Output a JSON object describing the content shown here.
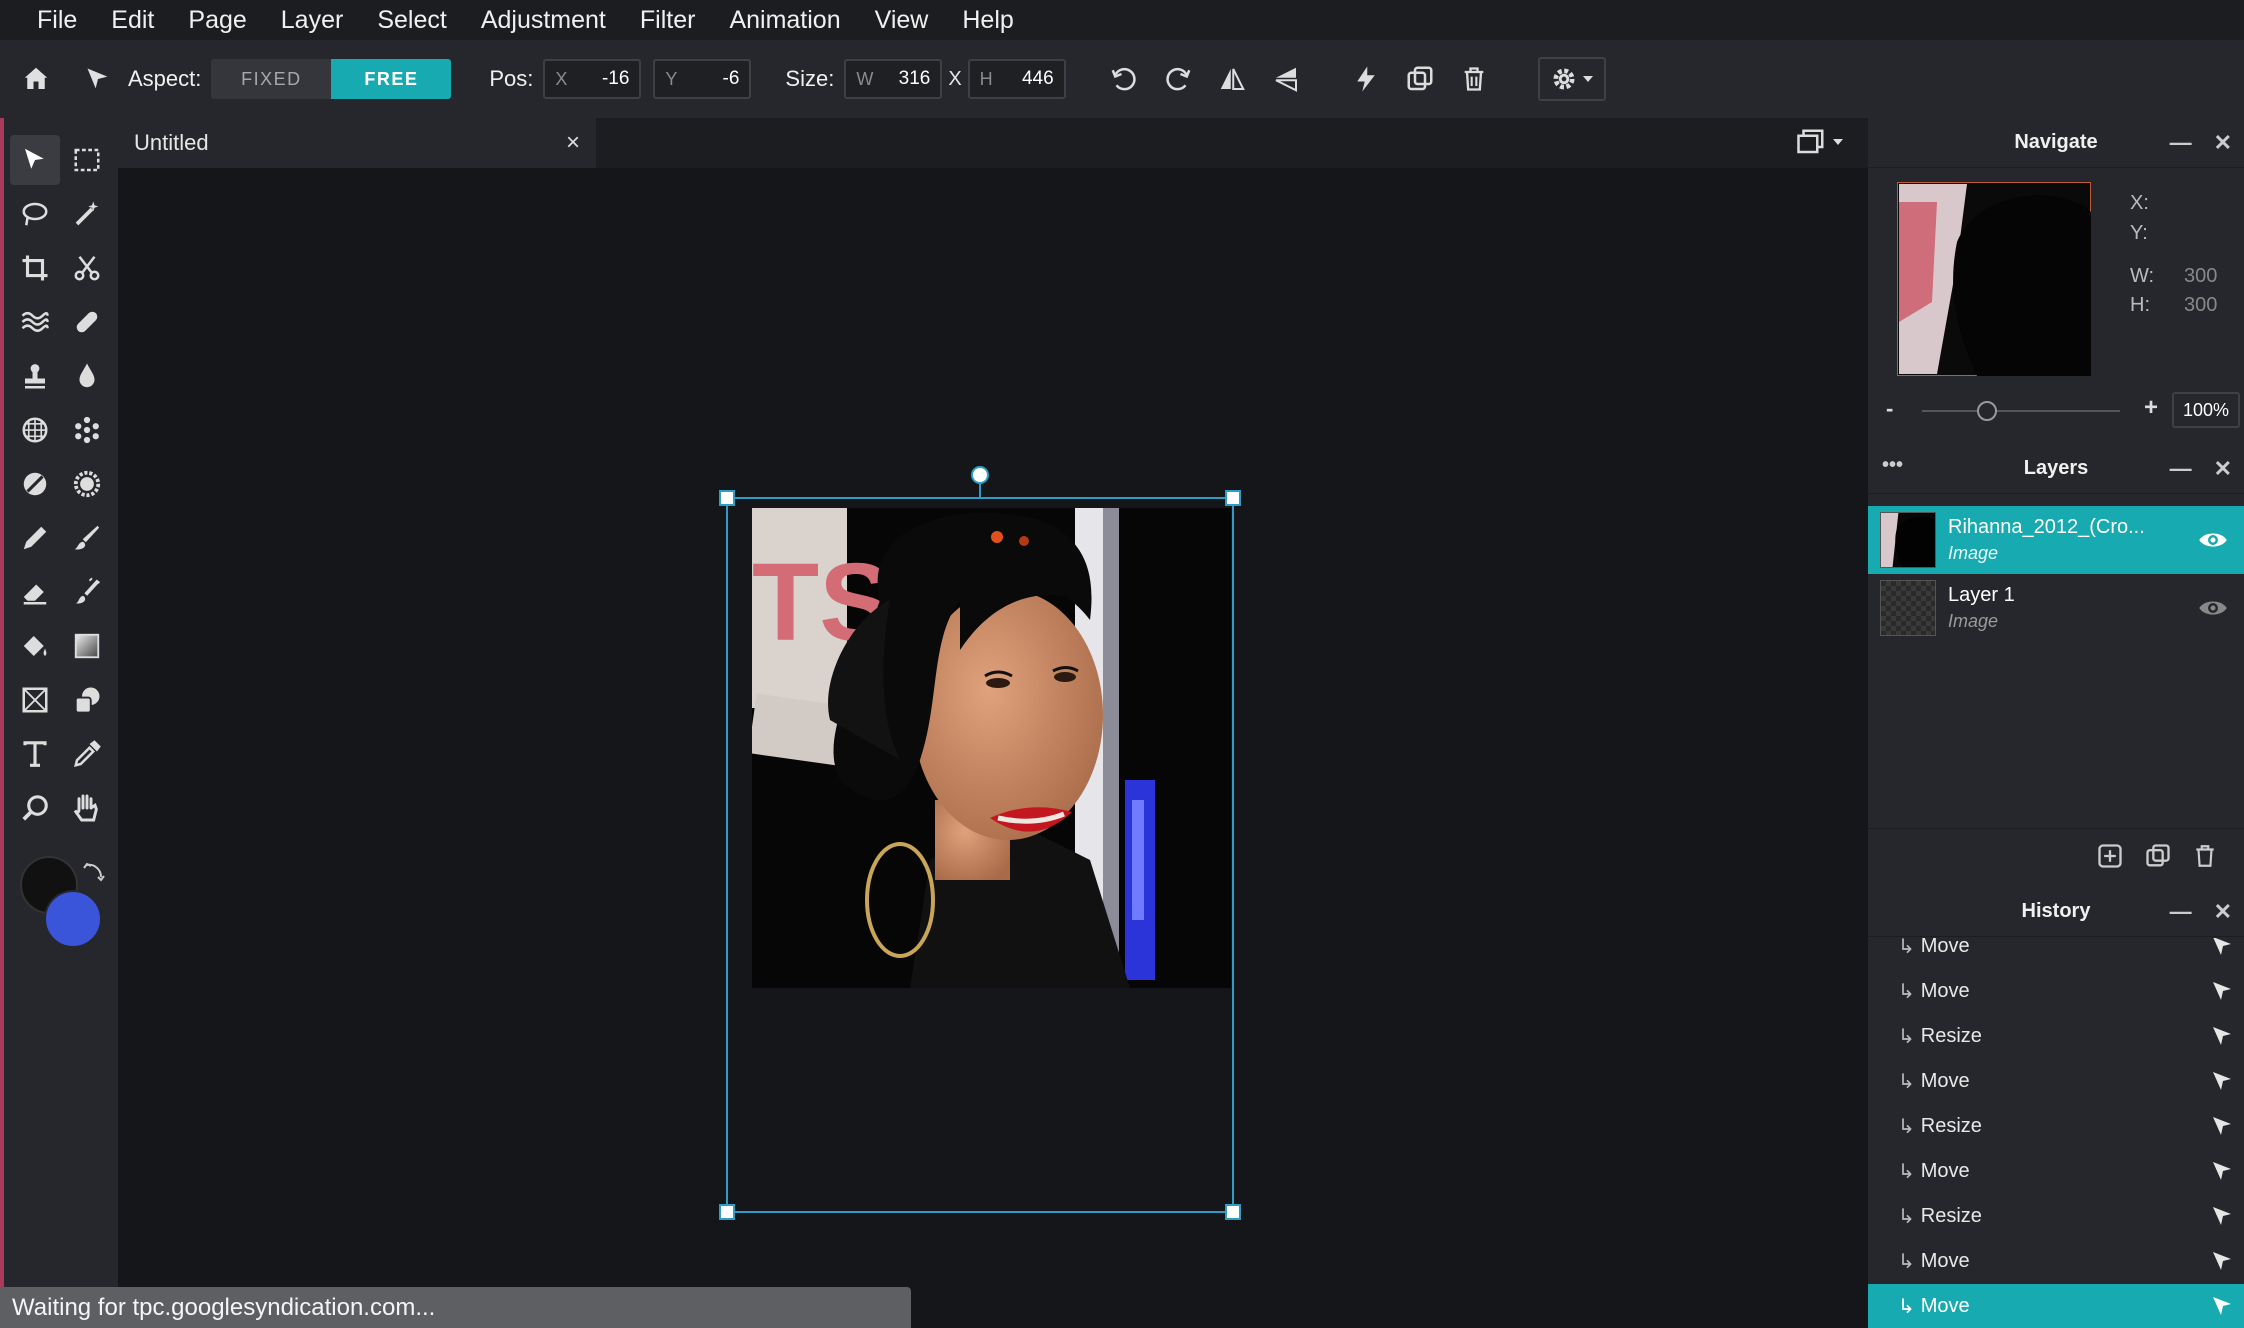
{
  "menu": [
    "File",
    "Edit",
    "Page",
    "Layer",
    "Select",
    "Adjustment",
    "Filter",
    "Animation",
    "View",
    "Help"
  ],
  "toolbar": {
    "aspect_label": "Aspect:",
    "fixed_label": "FIXED",
    "free_label": "FREE",
    "pos_label": "Pos:",
    "x_prefix": "X",
    "x_value": "-16",
    "y_prefix": "Y",
    "y_value": "-6",
    "size_label": "Size:",
    "w_prefix": "W",
    "w_value": "316",
    "times": "X",
    "h_prefix": "H",
    "h_value": "446"
  },
  "document": {
    "tab_title": "Untitled",
    "close": "×"
  },
  "navigate": {
    "title": "Navigate",
    "x_label": "X:",
    "y_label": "Y:",
    "w_label": "W:",
    "w_value": "300",
    "h_label": "H:",
    "h_value": "300",
    "zoom_minus": "-",
    "zoom_plus": "+",
    "zoom_value": "100%",
    "zoom_level": 0.33
  },
  "layers": {
    "title": "Layers",
    "menu": "•••",
    "items": [
      {
        "name": "Rihanna_2012_(Cro...",
        "type": "Image"
      },
      {
        "name": "Layer 1",
        "type": "Image"
      }
    ]
  },
  "history": {
    "title": "History",
    "items": [
      "Move",
      "Move",
      "Resize",
      "Move",
      "Resize",
      "Move",
      "Resize",
      "Move",
      "Move"
    ]
  },
  "status": "Waiting for tpc.googlesyndication.com...",
  "colors": {
    "accent": "#18aab1",
    "foreground": "#111111",
    "background": "#3a55d9"
  }
}
